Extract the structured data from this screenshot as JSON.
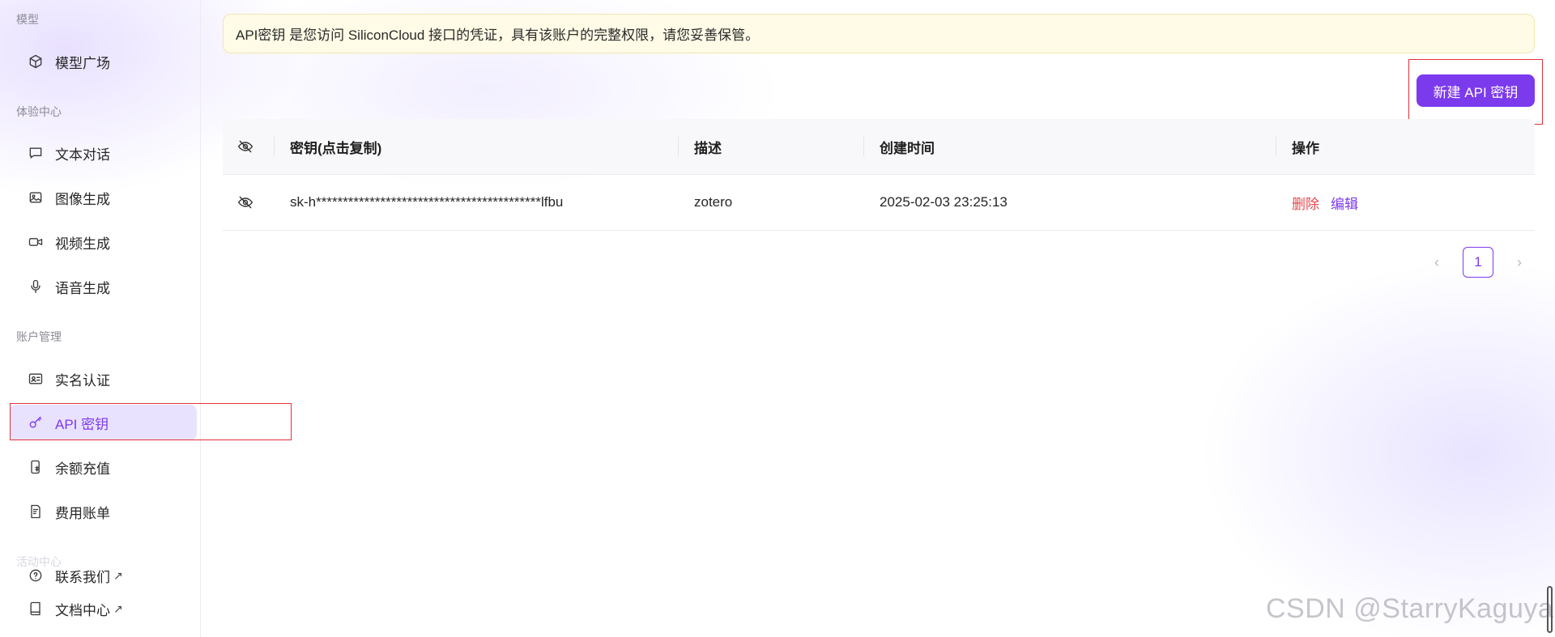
{
  "sidebar": {
    "groups": [
      {
        "label": "模型"
      },
      {
        "label": "体验中心"
      },
      {
        "label": "账户管理"
      },
      {
        "label": "活动中心"
      }
    ],
    "items": [
      {
        "label": "模型广场",
        "icon": "cube-icon"
      },
      {
        "label": "文本对话",
        "icon": "chat-icon"
      },
      {
        "label": "图像生成",
        "icon": "image-icon"
      },
      {
        "label": "视频生成",
        "icon": "video-icon"
      },
      {
        "label": "语音生成",
        "icon": "mic-icon"
      },
      {
        "label": "实名认证",
        "icon": "id-card-icon"
      },
      {
        "label": "API 密钥",
        "icon": "key-icon",
        "active": true
      },
      {
        "label": "余额充值",
        "icon": "recharge-icon"
      },
      {
        "label": "费用账单",
        "icon": "bill-icon"
      },
      {
        "label": "联系我们",
        "icon": "help-icon",
        "external": "↗"
      },
      {
        "label": "文档中心",
        "icon": "book-icon",
        "external": "↗"
      }
    ]
  },
  "notice": {
    "text": "API密钥 是您访问 SiliconCloud 接口的凭证，具有该账户的完整权限，请您妥善保管。"
  },
  "toolbar": {
    "new_key_label": "新建 API 密钥"
  },
  "table": {
    "columns": [
      "密钥(点击复制)",
      "描述",
      "创建时间",
      "操作"
    ],
    "rows": [
      {
        "key": "sk-h******************************************lfbu",
        "description": "zotero",
        "created": "2025-02-03 23:25:13",
        "delete_label": "删除",
        "edit_label": "编辑"
      }
    ]
  },
  "pagination": {
    "current": "1",
    "prev": "‹",
    "next": "›"
  },
  "watermark": "CSDN @StarryKaguya",
  "colors": {
    "accent": "#7c3aed",
    "danger": "#e5484d",
    "notice_bg": "#fffbe6"
  }
}
